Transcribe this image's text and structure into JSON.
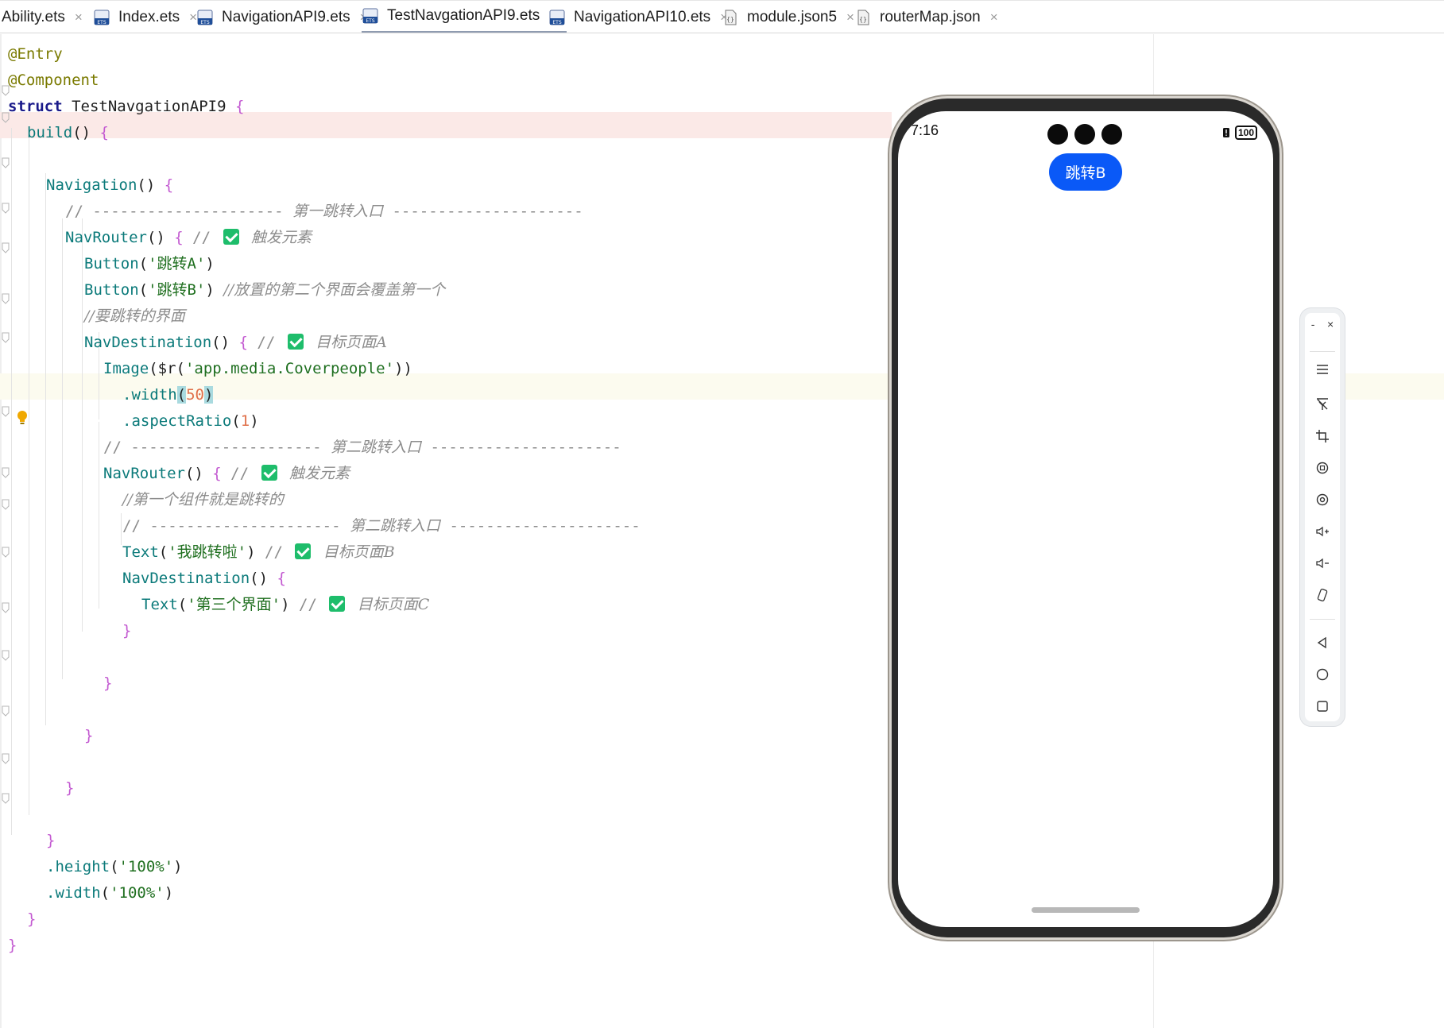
{
  "tabs": [
    {
      "label": "Ability.ets",
      "icon": "none",
      "active": false
    },
    {
      "label": "Index.ets",
      "icon": "ets-file-icon",
      "active": false
    },
    {
      "label": "NavigationAPI9.ets",
      "icon": "ets-file-icon",
      "active": false
    },
    {
      "label": "TestNavgationAPI9.ets",
      "icon": "ets-file-icon",
      "active": true
    },
    {
      "label": "NavigationAPI10.ets",
      "icon": "ets-file-icon",
      "active": false
    },
    {
      "label": "module.json5",
      "icon": "json-file-icon",
      "active": false
    },
    {
      "label": "routerMap.json",
      "icon": "json-file-icon",
      "active": false
    }
  ],
  "tab_close_glyph": "×",
  "code": {
    "l1": "@Entry",
    "l2": "@Component",
    "l3_kw": "struct",
    "l3_name": " TestNavgationAPI9 ",
    "l3_br": "{",
    "l4_fn": "build",
    "l4_paren": "() ",
    "l4_br": "{",
    "l6_fn": "Navigation",
    "l6_paren": "() ",
    "l6_br": "{",
    "l7_slash": "// ",
    "l7_dash1": "--------------------- ",
    "l7_text": "第一跳转入口",
    "l7_dash2": " ---------------------",
    "l8_fn": "NavRouter",
    "l8_paren": "() ",
    "l8_br": "{",
    "l8_slash": " // ",
    "l8_cm": "触发元素",
    "l9_fn": "Button",
    "l9_open": "(",
    "l9_str": "'跳转A'",
    "l9_close": ")",
    "l10_fn": "Button",
    "l10_open": "(",
    "l10_str": "'跳转B'",
    "l10_close": ") ",
    "l10_cm": "//放置的第二个界面会覆盖第一个",
    "l11_cm": "//要跳转的界面",
    "l12_fn": "NavDestination",
    "l12_paren": "() ",
    "l12_br": "{",
    "l12_slash": " // ",
    "l12_cm": "目标页面A",
    "l13_fn": "Image",
    "l13_open": "($r(",
    "l13_str": "'app.media.Coverpeople'",
    "l13_close": "))",
    "l14_fn": ".width",
    "l14_open": "(",
    "l14_num": "50",
    "l14_close": ")",
    "l15_fn": ".aspectRatio",
    "l15_open": "(",
    "l15_num": "1",
    "l15_close": ")",
    "l16_slash": "// ",
    "l16_dash1": "--------------------- ",
    "l16_text": "第二跳转入口",
    "l16_dash2": " ---------------------",
    "l17_fn": "NavRouter",
    "l17_paren": "() ",
    "l17_br": "{",
    "l17_slash": " // ",
    "l17_cm": "触发元素",
    "l18_cm": "//第一个组件就是跳转的",
    "l19_slash": "// ",
    "l19_dash1": "--------------------- ",
    "l19_text": "第二跳转入口",
    "l19_dash2": " ---------------------",
    "l20_fn": "Text",
    "l20_open": "(",
    "l20_str": "'我跳转啦'",
    "l20_close": ") ",
    "l20_slash": "// ",
    "l20_cm": "目标页面B",
    "l21_fn": "NavDestination",
    "l21_paren": "() ",
    "l21_br": "{",
    "l22_fn": "Text",
    "l22_open": "(",
    "l22_str": "'第三个界面'",
    "l22_close": ") ",
    "l22_slash": "// ",
    "l22_cm": "目标页面C",
    "close_brace": "}",
    "l32_fn": ".height",
    "l32_open": "(",
    "l32_str": "'100%'",
    "l32_close": ")",
    "l33_fn": ".width",
    "l33_open": "(",
    "l33_str": "'100%'",
    "l33_close": ")"
  },
  "phone": {
    "time": "7:16",
    "battery": "100",
    "button_label": "跳转B",
    "accent": "#0a59f7"
  },
  "emulator_toolbar": {
    "minimize": "-",
    "close": "×",
    "items": [
      "menu-icon",
      "pin-icon",
      "screenshot-crop-icon",
      "rotate-icon",
      "record-icon",
      "volume-up-icon",
      "volume-down-icon",
      "shake-icon",
      "back-icon",
      "home-icon",
      "recents-icon"
    ]
  }
}
